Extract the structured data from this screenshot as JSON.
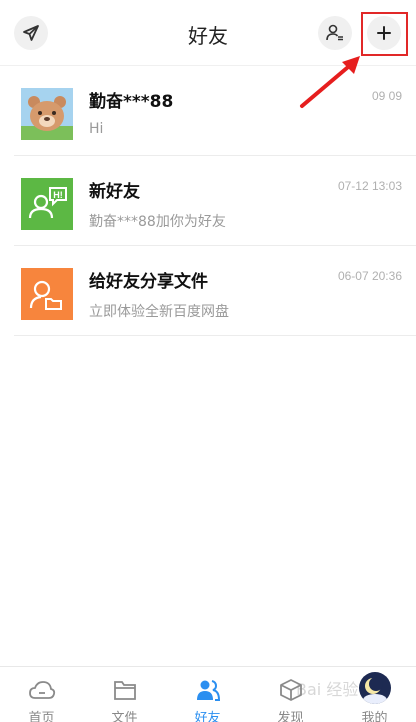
{
  "header": {
    "title": "好友"
  },
  "friends": [
    {
      "name": "勤奋***88",
      "subtitle": "Hi",
      "time": "09 09"
    },
    {
      "name": "新好友",
      "subtitle": "勤奋***88加你为好友",
      "time": "07-12 13:03"
    },
    {
      "name": "给好友分享文件",
      "subtitle": "立即体验全新百度网盘",
      "time": "06-07 20:36"
    }
  ],
  "new_friend_badge": "H!",
  "tabs": [
    {
      "label": "首页",
      "icon": "cloud-icon"
    },
    {
      "label": "文件",
      "icon": "folder-icon"
    },
    {
      "label": "好友",
      "icon": "friends-icon",
      "active": true
    },
    {
      "label": "发现",
      "icon": "discover-icon"
    },
    {
      "label": "我的",
      "icon": "avatar"
    }
  ],
  "watermark": "Bai 经验",
  "colors": {
    "accent": "#2b8ff0",
    "highlight": "#e12828",
    "new_friend_avatar": "#5cb844",
    "share_avatar": "#f7853d"
  }
}
